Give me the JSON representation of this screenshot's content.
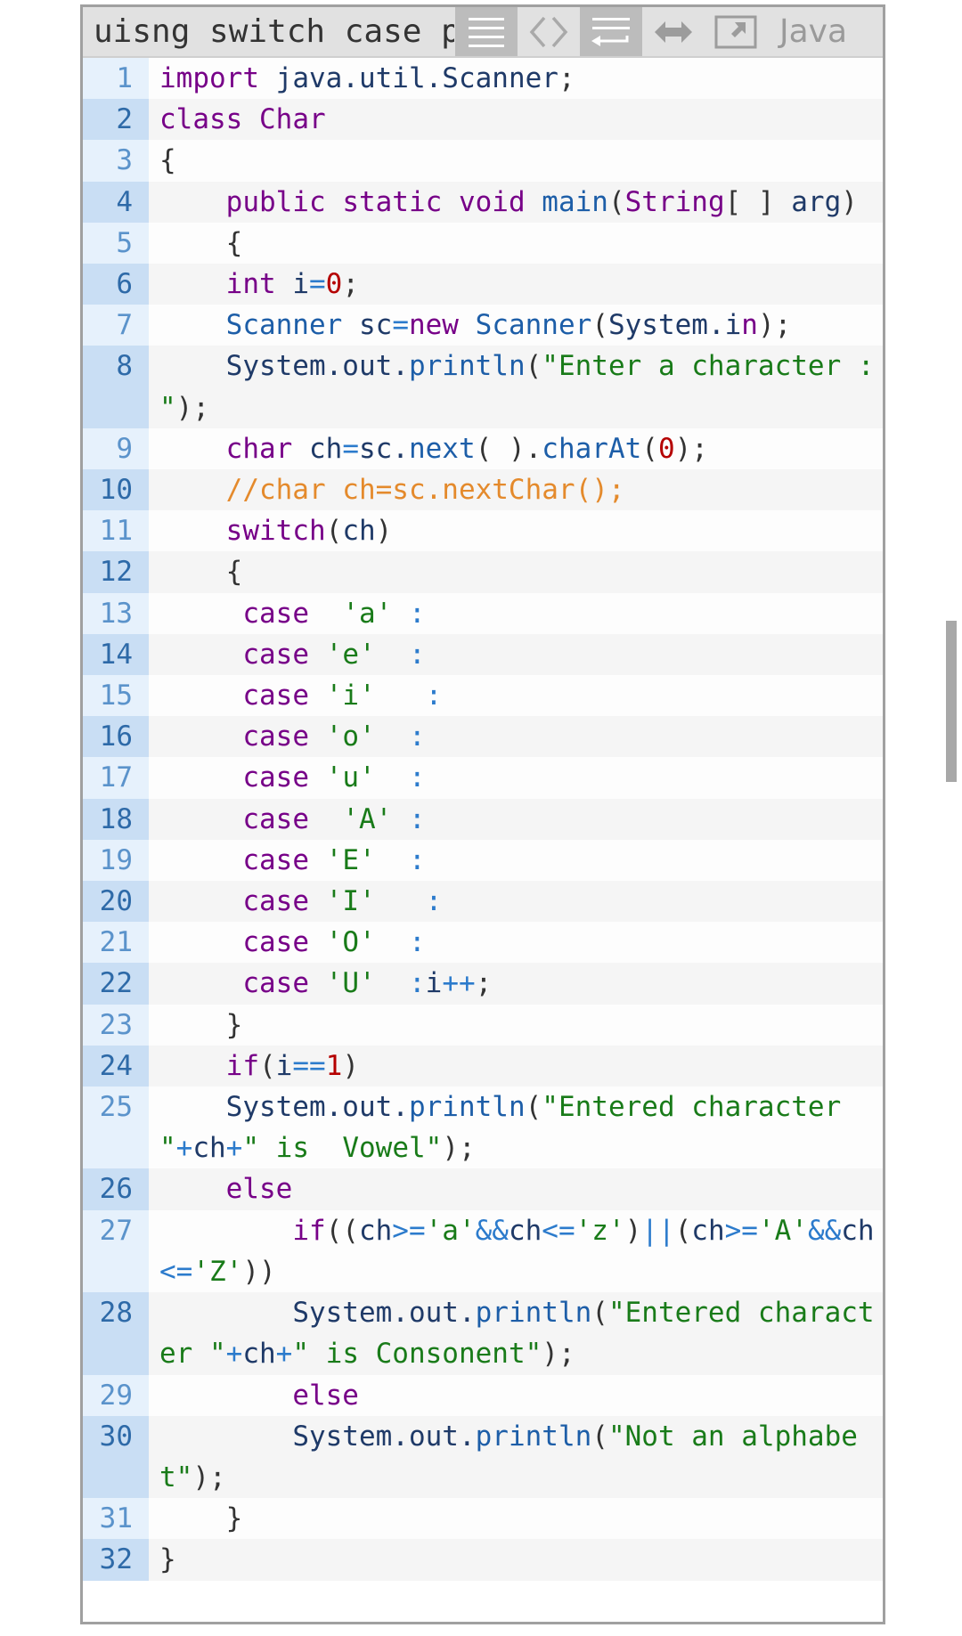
{
  "header": {
    "title": "uisng switch case p",
    "language": "Java",
    "toolbar": [
      {
        "name": "line-numbers-toggle",
        "icon": "list-lines-icon",
        "active": true
      },
      {
        "name": "view-source",
        "icon": "code-brackets-icon",
        "active": false
      },
      {
        "name": "wrap-toggle",
        "icon": "wrap-lines-icon",
        "active": true
      },
      {
        "name": "expand",
        "icon": "horizontal-arrows-icon",
        "active": false
      },
      {
        "name": "open-popup",
        "icon": "popout-icon",
        "active": false
      }
    ]
  },
  "code": {
    "lines": [
      {
        "n": "1",
        "tokens": [
          [
            "kw",
            "import"
          ],
          [
            "pn",
            " "
          ],
          [
            "id",
            "java.util.Scanner"
          ],
          [
            "pn",
            ";"
          ]
        ]
      },
      {
        "n": "2",
        "tokens": [
          [
            "kw",
            "class"
          ],
          [
            "pn",
            " "
          ],
          [
            "kw",
            "Char"
          ]
        ]
      },
      {
        "n": "3",
        "tokens": [
          [
            "pn",
            "{"
          ]
        ]
      },
      {
        "n": "4",
        "tokens": [
          [
            "pn",
            "    "
          ],
          [
            "kw",
            "public"
          ],
          [
            "pn",
            " "
          ],
          [
            "kw",
            "static"
          ],
          [
            "pn",
            " "
          ],
          [
            "kw",
            "void"
          ],
          [
            "pn",
            " "
          ],
          [
            "fn",
            "main"
          ],
          [
            "pn",
            "("
          ],
          [
            "kw",
            "String"
          ],
          [
            "pn",
            "[ ] "
          ],
          [
            "id",
            "arg"
          ],
          [
            "pn",
            ")"
          ]
        ]
      },
      {
        "n": "5",
        "tokens": [
          [
            "pn",
            "    {"
          ]
        ]
      },
      {
        "n": "6",
        "tokens": [
          [
            "pn",
            "    "
          ],
          [
            "kw",
            "int"
          ],
          [
            "pn",
            " "
          ],
          [
            "id",
            "i"
          ],
          [
            "op",
            "="
          ],
          [
            "nm",
            "0"
          ],
          [
            "pn",
            ";"
          ]
        ]
      },
      {
        "n": "7",
        "tokens": [
          [
            "pn",
            "    "
          ],
          [
            "fn",
            "Scanner"
          ],
          [
            "pn",
            " "
          ],
          [
            "id",
            "sc"
          ],
          [
            "op",
            "="
          ],
          [
            "kw",
            "new"
          ],
          [
            "pn",
            " "
          ],
          [
            "fn",
            "Scanner"
          ],
          [
            "pn",
            "("
          ],
          [
            "id",
            "System.i"
          ],
          [
            "kw",
            "n"
          ],
          [
            "pn",
            ");"
          ]
        ]
      },
      {
        "n": "8",
        "tokens": [
          [
            "pn",
            "    "
          ],
          [
            "id",
            "System.out."
          ],
          [
            "fn",
            "println"
          ],
          [
            "pn",
            "("
          ],
          [
            "st",
            "\"Enter a character : \""
          ],
          [
            "pn",
            ");"
          ]
        ]
      },
      {
        "n": "9",
        "tokens": [
          [
            "pn",
            "    "
          ],
          [
            "kw",
            "char"
          ],
          [
            "pn",
            " "
          ],
          [
            "id",
            "ch"
          ],
          [
            "op",
            "="
          ],
          [
            "id",
            "sc."
          ],
          [
            "fn",
            "next"
          ],
          [
            "pn",
            "( )."
          ],
          [
            "fn",
            "charAt"
          ],
          [
            "pn",
            "("
          ],
          [
            "nm",
            "0"
          ],
          [
            "pn",
            ");"
          ]
        ]
      },
      {
        "n": "10",
        "tokens": [
          [
            "pn",
            "    "
          ],
          [
            "cm",
            "//char ch=sc.nextChar();"
          ]
        ]
      },
      {
        "n": "11",
        "tokens": [
          [
            "pn",
            "    "
          ],
          [
            "kw",
            "switch"
          ],
          [
            "pn",
            "("
          ],
          [
            "id",
            "ch"
          ],
          [
            "pn",
            ")"
          ]
        ]
      },
      {
        "n": "12",
        "tokens": [
          [
            "pn",
            "    {"
          ]
        ]
      },
      {
        "n": "13",
        "tokens": [
          [
            "pn",
            "     "
          ],
          [
            "kw",
            "case"
          ],
          [
            "pn",
            "  "
          ],
          [
            "st",
            "'a'"
          ],
          [
            "pn",
            " "
          ],
          [
            "op",
            ":"
          ]
        ]
      },
      {
        "n": "14",
        "tokens": [
          [
            "pn",
            "     "
          ],
          [
            "kw",
            "case"
          ],
          [
            "pn",
            " "
          ],
          [
            "st",
            "'e'"
          ],
          [
            "pn",
            "  "
          ],
          [
            "op",
            ":"
          ]
        ]
      },
      {
        "n": "15",
        "tokens": [
          [
            "pn",
            "     "
          ],
          [
            "kw",
            "case"
          ],
          [
            "pn",
            " "
          ],
          [
            "st",
            "'i'"
          ],
          [
            "pn",
            "   "
          ],
          [
            "op",
            ":"
          ]
        ]
      },
      {
        "n": "16",
        "tokens": [
          [
            "pn",
            "     "
          ],
          [
            "kw",
            "case"
          ],
          [
            "pn",
            " "
          ],
          [
            "st",
            "'o'"
          ],
          [
            "pn",
            "  "
          ],
          [
            "op",
            ":"
          ]
        ]
      },
      {
        "n": "17",
        "tokens": [
          [
            "pn",
            "     "
          ],
          [
            "kw",
            "case"
          ],
          [
            "pn",
            " "
          ],
          [
            "st",
            "'u'"
          ],
          [
            "pn",
            "  "
          ],
          [
            "op",
            ":"
          ]
        ]
      },
      {
        "n": "18",
        "tokens": [
          [
            "pn",
            "     "
          ],
          [
            "kw",
            "case"
          ],
          [
            "pn",
            "  "
          ],
          [
            "st",
            "'A'"
          ],
          [
            "pn",
            " "
          ],
          [
            "op",
            ":"
          ]
        ]
      },
      {
        "n": "19",
        "tokens": [
          [
            "pn",
            "     "
          ],
          [
            "kw",
            "case"
          ],
          [
            "pn",
            " "
          ],
          [
            "st",
            "'E'"
          ],
          [
            "pn",
            "  "
          ],
          [
            "op",
            ":"
          ]
        ]
      },
      {
        "n": "20",
        "tokens": [
          [
            "pn",
            "     "
          ],
          [
            "kw",
            "case"
          ],
          [
            "pn",
            " "
          ],
          [
            "st",
            "'I'"
          ],
          [
            "pn",
            "   "
          ],
          [
            "op",
            ":"
          ]
        ]
      },
      {
        "n": "21",
        "tokens": [
          [
            "pn",
            "     "
          ],
          [
            "kw",
            "case"
          ],
          [
            "pn",
            " "
          ],
          [
            "st",
            "'O'"
          ],
          [
            "pn",
            "  "
          ],
          [
            "op",
            ":"
          ]
        ]
      },
      {
        "n": "22",
        "tokens": [
          [
            "pn",
            "     "
          ],
          [
            "kw",
            "case"
          ],
          [
            "pn",
            " "
          ],
          [
            "st",
            "'U'"
          ],
          [
            "pn",
            "  "
          ],
          [
            "op",
            ":"
          ],
          [
            "id",
            "i"
          ],
          [
            "op",
            "++"
          ],
          [
            "pn",
            ";"
          ]
        ]
      },
      {
        "n": "23",
        "tokens": [
          [
            "pn",
            "    }"
          ]
        ]
      },
      {
        "n": "24",
        "tokens": [
          [
            "pn",
            "    "
          ],
          [
            "kw",
            "if"
          ],
          [
            "pn",
            "("
          ],
          [
            "id",
            "i"
          ],
          [
            "op",
            "=="
          ],
          [
            "nm",
            "1"
          ],
          [
            "pn",
            ")"
          ]
        ]
      },
      {
        "n": "25",
        "tokens": [
          [
            "pn",
            "    "
          ],
          [
            "id",
            "System.out."
          ],
          [
            "fn",
            "println"
          ],
          [
            "pn",
            "("
          ],
          [
            "st",
            "\"Entered character \""
          ],
          [
            "op",
            "+"
          ],
          [
            "id",
            "ch"
          ],
          [
            "op",
            "+"
          ],
          [
            "st",
            "\" is  Vowel\""
          ],
          [
            "pn",
            ");"
          ]
        ]
      },
      {
        "n": "26",
        "tokens": [
          [
            "pn",
            "    "
          ],
          [
            "kw",
            "else"
          ]
        ]
      },
      {
        "n": "27",
        "tokens": [
          [
            "pn",
            "        "
          ],
          [
            "kw",
            "if"
          ],
          [
            "pn",
            "(("
          ],
          [
            "id",
            "ch"
          ],
          [
            "op",
            ">="
          ],
          [
            "st",
            "'a'"
          ],
          [
            "op",
            "&&"
          ],
          [
            "id",
            "ch"
          ],
          [
            "op",
            "<="
          ],
          [
            "st",
            "'z'"
          ],
          [
            "pn",
            ")"
          ],
          [
            "op",
            "||"
          ],
          [
            "pn",
            "("
          ],
          [
            "id",
            "ch"
          ],
          [
            "op",
            ">="
          ],
          [
            "st",
            "'A'"
          ],
          [
            "op",
            "&&"
          ],
          [
            "id",
            "ch"
          ],
          [
            "op",
            "<="
          ],
          [
            "st",
            "'Z'"
          ],
          [
            "pn",
            "))"
          ]
        ]
      },
      {
        "n": "28",
        "tokens": [
          [
            "pn",
            "        "
          ],
          [
            "id",
            "System.out."
          ],
          [
            "fn",
            "println"
          ],
          [
            "pn",
            "("
          ],
          [
            "st",
            "\"Entered character \""
          ],
          [
            "op",
            "+"
          ],
          [
            "id",
            "ch"
          ],
          [
            "op",
            "+"
          ],
          [
            "st",
            "\" is Consonent\""
          ],
          [
            "pn",
            ");"
          ]
        ]
      },
      {
        "n": "29",
        "tokens": [
          [
            "pn",
            "        "
          ],
          [
            "kw",
            "else"
          ]
        ]
      },
      {
        "n": "30",
        "tokens": [
          [
            "pn",
            "        "
          ],
          [
            "id",
            "System.out."
          ],
          [
            "fn",
            "println"
          ],
          [
            "pn",
            "("
          ],
          [
            "st",
            "\"Not an alphabet\""
          ],
          [
            "pn",
            ");"
          ]
        ]
      },
      {
        "n": "31",
        "tokens": [
          [
            "pn",
            "    }"
          ]
        ]
      },
      {
        "n": "32",
        "tokens": [
          [
            "pn",
            "}"
          ]
        ]
      }
    ]
  },
  "colors": {
    "keyword": "#770088",
    "identifier": "#1f3a68",
    "function": "#1d5ea8",
    "operator": "#2c7bcc",
    "string": "#197b19",
    "number": "#b50000",
    "comment": "#e48a2c",
    "gutter_even": "#c9def4",
    "gutter_odd": "#e6f1fc",
    "header_bg": "#e1e1e1"
  }
}
